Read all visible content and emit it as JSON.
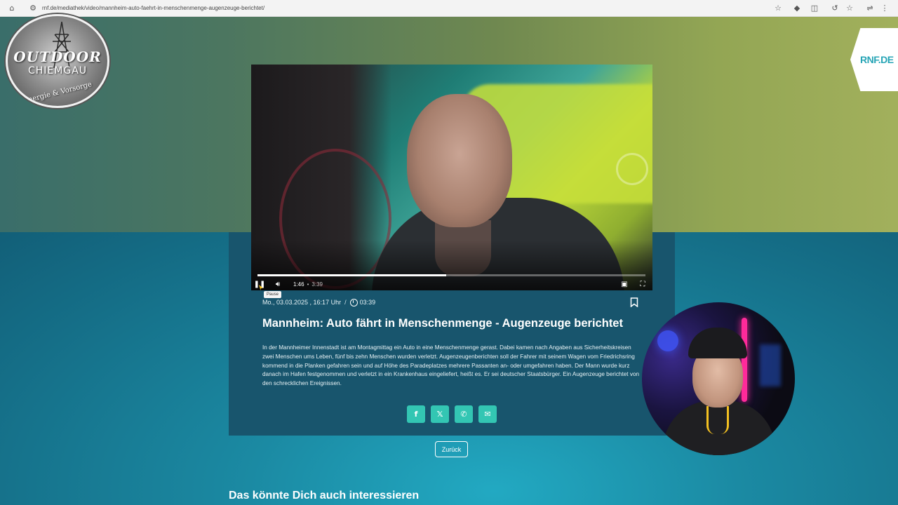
{
  "browser": {
    "url": "rnf.de/mediathek/video/mannheim-auto-faehrt-in-menschenmenge-augenzeuge-berichtet/"
  },
  "overlay_logo": {
    "line1": "OUTDOOR",
    "line2": "CHIEMGAU",
    "line3": "Energie & Vorsorge"
  },
  "site_logo": {
    "text": "RNF.DE"
  },
  "player": {
    "current_time": "1:46",
    "separator": "•",
    "duration": "3:39",
    "progress_fraction": 0.487,
    "tooltip": "Pause"
  },
  "article": {
    "date": "Mo., 03.03.2025 , 16:17 Uhr",
    "meta_sep": "/",
    "duration": "03:39",
    "title": "Mannheim: Auto fährt in Menschenmenge - Augenzeuge berichtet",
    "description": "In der Mannheimer Innenstadt ist am Montagmittag ein Auto in eine Menschenmenge gerast. Dabei kamen nach Angaben aus Sicherheitskreisen zwei Menschen ums Leben, fünf bis zehn Menschen wurden verletzt. Augenzeugenberichten soll der Fahrer mit seinem Wagen vom Friedrichsring kommend in die Planken gefahren sein und auf Höhe des Paradeplatzes mehrere Passanten an- oder umgefahren haben. Der Mann wurde kurz danach im Hafen festgenommen und verletzt in ein Krankenhaus eingeliefert, heißt es. Er sei deutscher Staatsbürger. Ein Augenzeuge berichtet von den schrecklichen Ereignissen."
  },
  "share": {
    "icons": [
      "facebook-icon",
      "x-icon",
      "whatsapp-icon",
      "email-icon"
    ],
    "glyphs": [
      "f",
      "𝕏",
      "✆",
      "✉"
    ],
    "color": "#33c6b3"
  },
  "back_button": {
    "label": "Zurück"
  },
  "related": {
    "heading": "Das könnte Dich auch interessieren"
  },
  "colors": {
    "panel": "#18556d",
    "accent": "#33c6b3"
  }
}
